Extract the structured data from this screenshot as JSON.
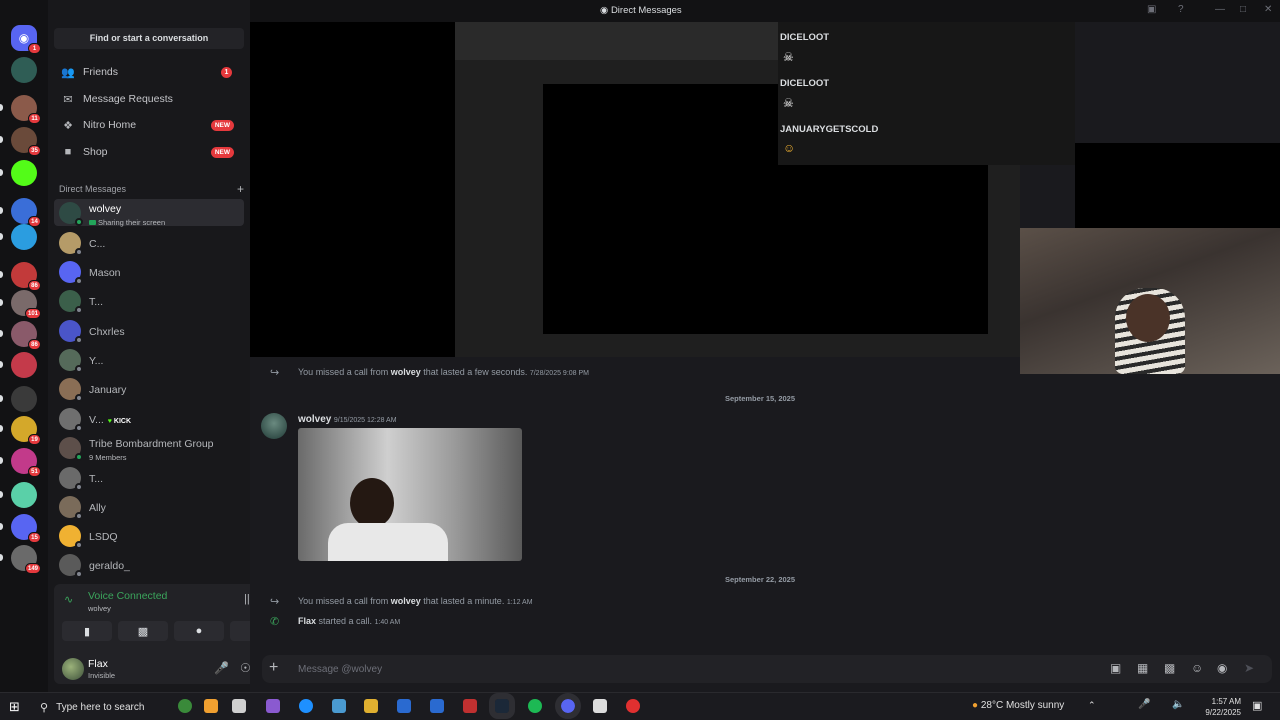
{
  "title": "Direct Messages",
  "sidebar": {
    "find_label": "Find or start a conversation",
    "nav": [
      {
        "label": "Friends",
        "count": "1"
      },
      {
        "label": "Message Requests"
      },
      {
        "label": "Nitro Home",
        "tag": "NEW"
      },
      {
        "label": "Shop",
        "tag": "NEW"
      }
    ],
    "dm_header": "Direct Messages",
    "dms": [
      {
        "name": "wolvey",
        "sub": "Sharing their screen",
        "color": "#2e4a44"
      },
      {
        "name": "C...",
        "color": "#b59b68"
      },
      {
        "name": "Mason",
        "color": "#5865f2"
      },
      {
        "name": "T...",
        "color": "#3b5f4a"
      },
      {
        "name": "Chxrles",
        "color": "#4a55c8"
      },
      {
        "name": "Y...",
        "color": "#556a5a"
      },
      {
        "name": "January",
        "color": "#8a6e55"
      },
      {
        "name": "V...",
        "kick": "KICK",
        "color": "#6f6f6f"
      },
      {
        "name": "Tribe Bombardment Group",
        "sub": "9 Members",
        "color": "#5d4f4a"
      },
      {
        "name": "T...",
        "color": "#6a6a6a"
      },
      {
        "name": "Ally",
        "color": "#7a6b5a"
      },
      {
        "name": "LSDQ",
        "color": "#f0b132"
      },
      {
        "name": "geraldo_",
        "color": "#5a5a5a"
      }
    ],
    "voice": {
      "status": "Voice Connected",
      "channel": "wolvey"
    },
    "user": {
      "name": "Flax",
      "status": "Invisible"
    }
  },
  "servers": [
    {
      "badge": "1",
      "color": "#5865f2"
    },
    {
      "color": "#2f5d55"
    },
    {
      "badge": "11",
      "color": "#8b5a4a"
    },
    {
      "badge": "35",
      "color": "#6a4a3a"
    },
    {
      "badge": "",
      "color": "#53fc18"
    },
    {
      "badge": "14",
      "color": "#3a6ed8"
    },
    {
      "color": "#2b9de0"
    },
    {
      "badge": "86",
      "color": "#c23a3a"
    },
    {
      "badge": "101",
      "color": "#7a6a6a"
    },
    {
      "badge": "86",
      "color": "#8a5a6a"
    },
    {
      "color": "#c43a4a"
    },
    {
      "color": "#3a3a3a"
    },
    {
      "badge": "19",
      "color": "#d4a82a"
    },
    {
      "badge": "51",
      "color": "#c23a8a"
    },
    {
      "color": "#5ad0a8"
    },
    {
      "badge": "15",
      "color": "#5865f2"
    },
    {
      "badge": "149",
      "color": "#6a6a6a"
    }
  ],
  "stream_chat": [
    {
      "name": "DICELOOT",
      "color": "#b66ce0"
    },
    {
      "name": "DICELOOT",
      "color": "#b66ce0"
    },
    {
      "name": "JANUARYGETSCOLD",
      "color": "#5fd04a"
    }
  ],
  "messages": {
    "missed1": {
      "pre": "You missed a call from",
      "who": "wolvey",
      "post": "that lasted a few seconds.",
      "time": "7/28/2025 9:08 PM"
    },
    "date1": "September 15, 2025",
    "post": {
      "author": "wolvey",
      "time": "9/15/2025 12:28 AM"
    },
    "date2": "September 22, 2025",
    "missed2": {
      "pre": "You missed a call from",
      "who": "wolvey",
      "post": "that lasted a minute.",
      "time": "1:12 AM"
    },
    "started": {
      "who": "Flax",
      "text": "started a call.",
      "time": "1:40 AM"
    }
  },
  "compose": {
    "placeholder": "Message @wolvey"
  },
  "taskbar": {
    "search_placeholder": "Type here to search",
    "weather": "28°C  Mostly sunny",
    "time": "1:57 AM",
    "date": "9/22/2025"
  }
}
